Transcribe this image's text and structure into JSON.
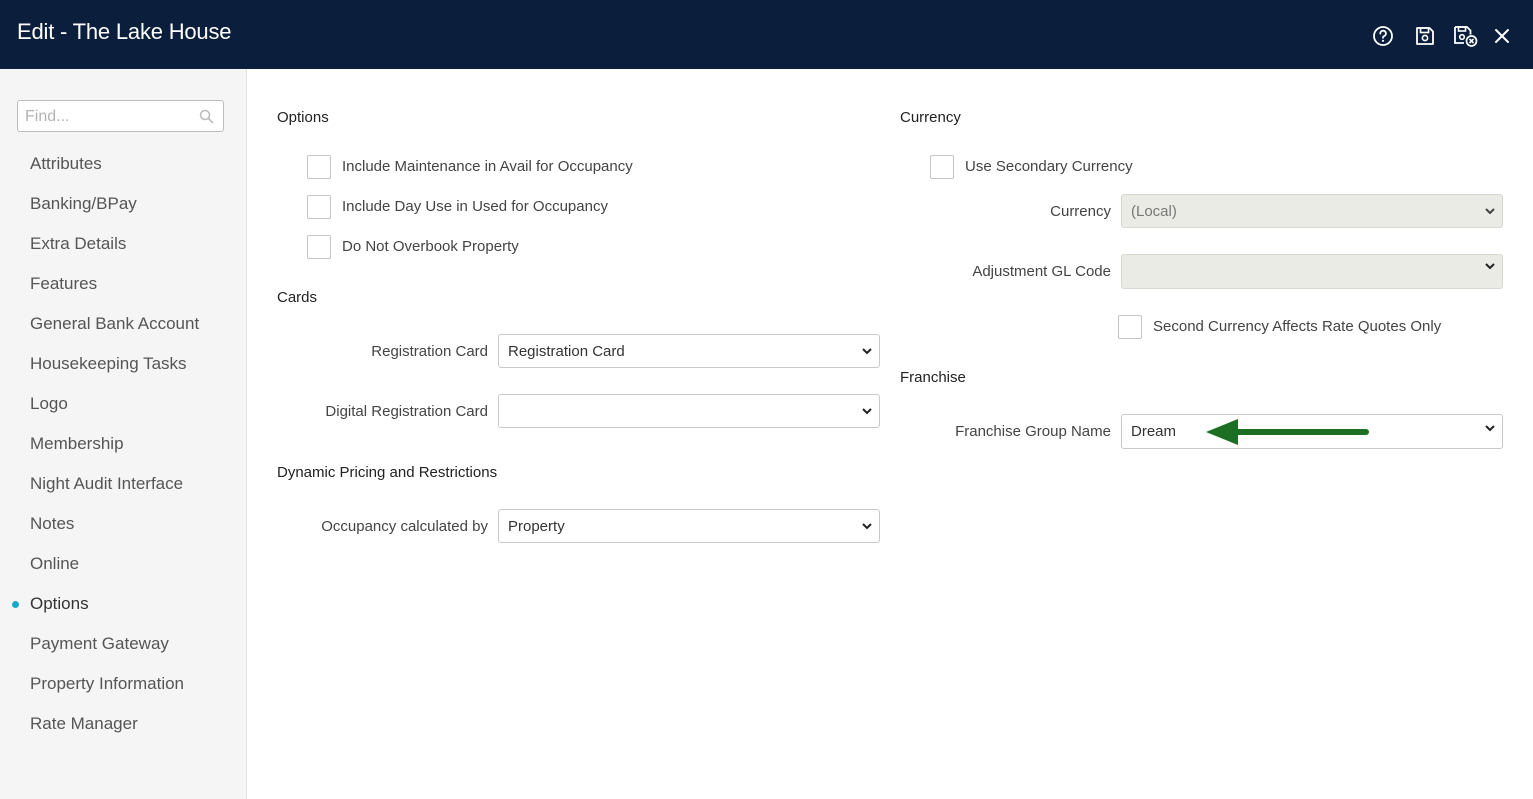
{
  "window": {
    "title": "Edit - The Lake House",
    "icons": [
      "help-icon",
      "save-icon",
      "save-and-close-icon",
      "close-icon"
    ]
  },
  "sidebar": {
    "search_placeholder": "Find...",
    "items": [
      {
        "label": "Attributes"
      },
      {
        "label": "Banking/BPay"
      },
      {
        "label": "Extra Details"
      },
      {
        "label": "Features"
      },
      {
        "label": "General Bank Account"
      },
      {
        "label": "Housekeeping Tasks"
      },
      {
        "label": "Logo"
      },
      {
        "label": "Membership"
      },
      {
        "label": "Night Audit Interface"
      },
      {
        "label": "Notes"
      },
      {
        "label": "Online"
      },
      {
        "label": "Options",
        "active": true
      },
      {
        "label": "Payment Gateway"
      },
      {
        "label": "Property Information"
      },
      {
        "label": "Rate Manager"
      }
    ]
  },
  "options": {
    "title": "Options",
    "checkboxes": [
      {
        "label": "Include Maintenance in Avail for Occupancy",
        "checked": false
      },
      {
        "label": "Include Day Use in Used for Occupancy",
        "checked": false
      },
      {
        "label": "Do Not Overbook Property",
        "checked": false
      }
    ]
  },
  "cards": {
    "title": "Cards",
    "registration_card": {
      "label": "Registration Card",
      "value": "Registration Card"
    },
    "digital_registration_card": {
      "label": "Digital Registration Card",
      "value": ""
    }
  },
  "dynamic_pricing": {
    "title": "Dynamic Pricing and Restrictions",
    "occupancy": {
      "label": "Occupancy calculated by",
      "value": "Property"
    }
  },
  "currency": {
    "title": "Currency",
    "use_secondary": {
      "label": "Use Secondary Currency",
      "checked": false
    },
    "currency": {
      "label": "Currency",
      "value": "(Local)"
    },
    "adjustment_gl": {
      "label": "Adjustment GL Code",
      "value": ""
    },
    "second_affects": {
      "label": "Second Currency Affects Rate Quotes Only",
      "checked": false
    }
  },
  "franchise": {
    "title": "Franchise",
    "group_name": {
      "label": "Franchise Group Name",
      "value": "Dream"
    }
  },
  "colors": {
    "header": "#0b1f3c",
    "accent": "#1aa8c8",
    "arrow": "#1b6e22"
  }
}
